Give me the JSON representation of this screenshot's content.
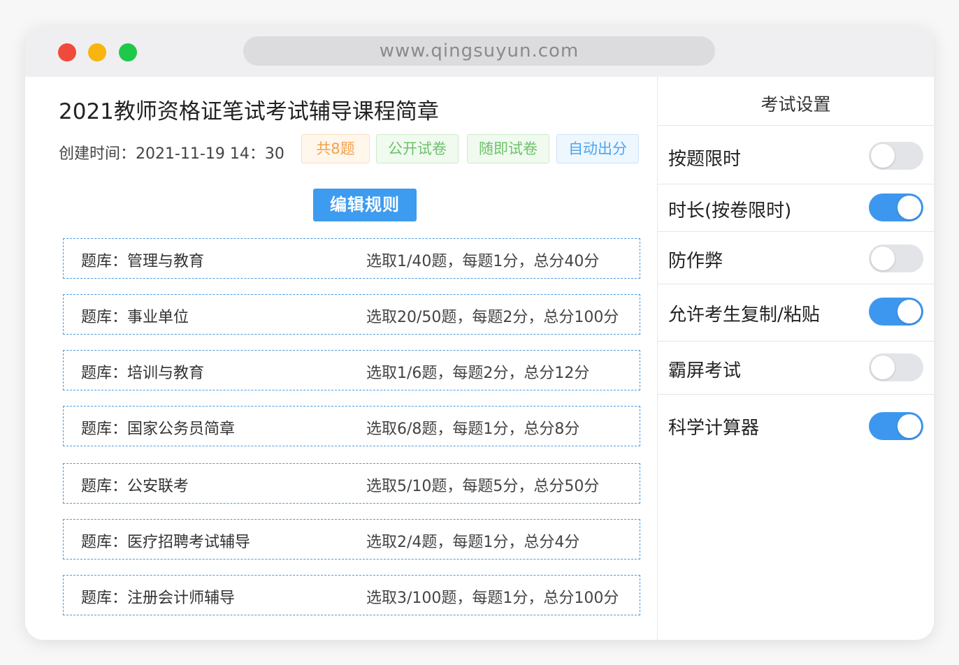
{
  "window": {
    "url": "www.qingsuyun.com"
  },
  "main": {
    "title": "2021教师资格证笔试考试辅导课程简章",
    "created": "创建时间：2021-11-19 14：30",
    "tags": [
      "共8题",
      "公开试卷",
      "随即试卷",
      "自动出分"
    ],
    "edit_button": "编辑规则",
    "rows": [
      {
        "label": "题库：管理与教育",
        "rule": "选取1/40题，每题1分，总分40分"
      },
      {
        "label": "题库：事业单位",
        "rule": "选取20/50题，每题2分，总分100分"
      },
      {
        "label": "题库：培训与教育",
        "rule": "选取1/6题，每题2分，总分12分"
      },
      {
        "label": "题库：国家公务员简章",
        "rule": "选取6/8题，每题1分，总分8分"
      },
      {
        "label": "题库：公安联考",
        "rule": "选取5/10题，每题5分，总分50分"
      },
      {
        "label": "题库：医疗招聘考试辅导",
        "rule": "选取2/4题，每题1分，总分4分"
      },
      {
        "label": "题库：注册会计师辅导",
        "rule": "选取3/100题，每题1分，总分100分"
      }
    ]
  },
  "settings": {
    "title": "考试设置",
    "items": [
      {
        "label": "按题限时",
        "on": false
      },
      {
        "label": "时长(按卷限时)",
        "on": true
      },
      {
        "label": "防作弊",
        "on": false
      },
      {
        "label": "允许考生复制/粘贴",
        "on": true
      },
      {
        "label": "霸屏考试",
        "on": false
      },
      {
        "label": "科学计算器",
        "on": true
      }
    ]
  },
  "colors": {
    "accent": "#3d9bf0",
    "toggle_off": "#e2e4e8"
  }
}
